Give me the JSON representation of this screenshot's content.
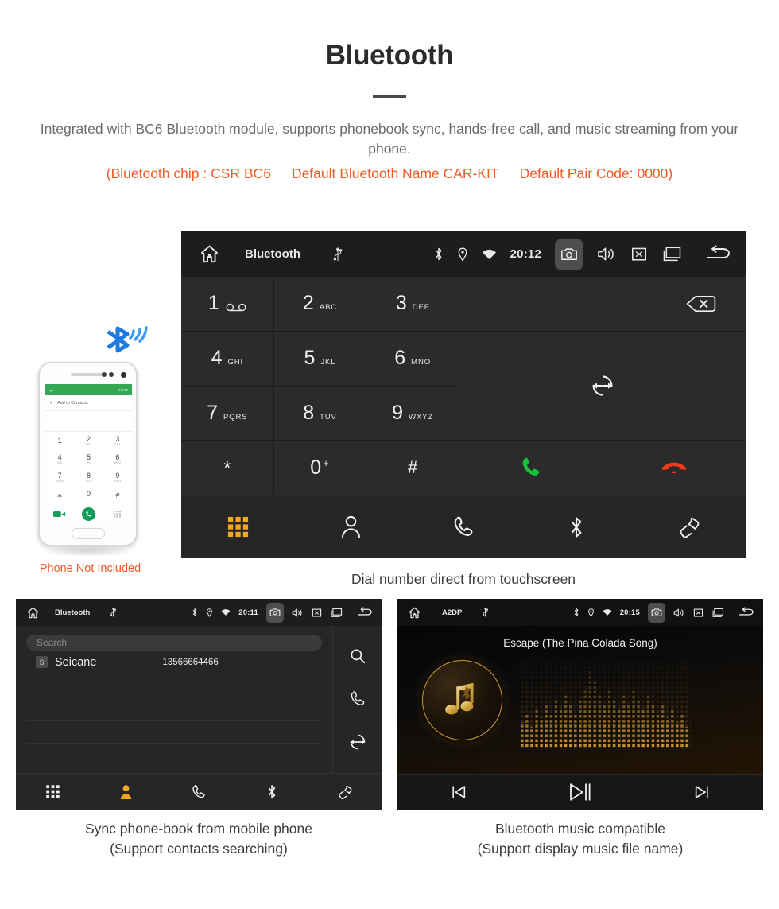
{
  "header": {
    "title": "Bluetooth",
    "subtitle": "Integrated with BC6 Bluetooth module, supports phonebook sync, hands-free call, and music streaming from your phone.",
    "spec_chip": "(Bluetooth chip : CSR BC6",
    "spec_name": "Default Bluetooth Name CAR-KIT",
    "spec_pair": "Default Pair Code: 0000)",
    "accent_color": "#f15a24",
    "body_color": "#6b6b6b"
  },
  "main_unit": {
    "statusbar": {
      "home_icon": "home-icon",
      "title": "Bluetooth",
      "usb_icon": "usb-icon",
      "bluetooth_icon": "bluetooth-icon",
      "location_icon": "location-pin-icon",
      "wifi_icon": "wifi-icon",
      "clock": "20:12",
      "camera_icon": "camera-icon",
      "volume_icon": "volume-icon",
      "mute_icon": "mute-icon",
      "recents_icon": "recents-icon",
      "back_icon": "back-icon"
    },
    "keys": [
      {
        "digit": "1",
        "sub": "",
        "sub_kind": "voicemail",
        "name": "key-1"
      },
      {
        "digit": "2",
        "sub": "ABC",
        "sub_kind": "letters",
        "name": "key-2"
      },
      {
        "digit": "3",
        "sub": "DEF",
        "sub_kind": "letters",
        "name": "key-3"
      },
      {
        "digit": "4",
        "sub": "GHI",
        "sub_kind": "letters",
        "name": "key-4"
      },
      {
        "digit": "5",
        "sub": "JKL",
        "sub_kind": "letters",
        "name": "key-5"
      },
      {
        "digit": "6",
        "sub": "MNO",
        "sub_kind": "letters",
        "name": "key-6"
      },
      {
        "digit": "7",
        "sub": "PQRS",
        "sub_kind": "letters",
        "name": "key-7"
      },
      {
        "digit": "8",
        "sub": "TUV",
        "sub_kind": "letters",
        "name": "key-8"
      },
      {
        "digit": "9",
        "sub": "WXYZ",
        "sub_kind": "letters",
        "name": "key-9"
      },
      {
        "digit": "*",
        "sub": "",
        "sub_kind": "none",
        "name": "key-star"
      },
      {
        "digit": "0",
        "sub": "+",
        "sub_kind": "plus",
        "name": "key-0"
      },
      {
        "digit": "#",
        "sub": "",
        "sub_kind": "none",
        "name": "key-hash"
      }
    ],
    "actions": {
      "backspace_icon": "backspace-icon",
      "sync_icon": "sync-icon",
      "call_icon": "call-icon",
      "hangup_icon": "hangup-icon",
      "call_color": "#14c33a",
      "hangup_color": "#ef3b1d"
    },
    "tabs": [
      {
        "name": "tab-keypad",
        "icon": "keypad-icon",
        "active": true
      },
      {
        "name": "tab-contacts",
        "icon": "contact-icon",
        "active": false
      },
      {
        "name": "tab-calllog",
        "icon": "phone-icon",
        "active": false
      },
      {
        "name": "tab-bluetooth",
        "icon": "bluetooth-icon",
        "active": false
      },
      {
        "name": "tab-link",
        "icon": "link-icon",
        "active": false
      }
    ],
    "active_tab_color": "#f5a623",
    "caption": "Dial number direct from touchscreen"
  },
  "phone_illustration": {
    "not_included_label": "Phone Not Included",
    "screen": {
      "back_icon": "back-arrow-icon",
      "more_label": "MORE",
      "add_contact_label": "Add to Contacts",
      "keys": [
        {
          "digit": "1",
          "sub": ""
        },
        {
          "digit": "2",
          "sub": "ABC"
        },
        {
          "digit": "3",
          "sub": "DEF"
        },
        {
          "digit": "4",
          "sub": "GHI"
        },
        {
          "digit": "5",
          "sub": "JKL"
        },
        {
          "digit": "6",
          "sub": "MNO"
        },
        {
          "digit": "7",
          "sub": "PQRS"
        },
        {
          "digit": "8",
          "sub": "TUV"
        },
        {
          "digit": "9",
          "sub": "WXYZ"
        },
        {
          "digit": "∗",
          "sub": ""
        },
        {
          "digit": "0",
          "sub": "+"
        },
        {
          "digit": "#",
          "sub": ""
        }
      ]
    },
    "bluetooth_wave_color": "#1f7ae0"
  },
  "phonebook_unit": {
    "statusbar": {
      "home_icon": "home-icon",
      "title": "Bluetooth",
      "usb_icon": "usb-icon",
      "clock": "20:11",
      "camera_icon": "camera-icon"
    },
    "search_placeholder": "Search",
    "contacts": [
      {
        "initial": "S",
        "name": "Seicane",
        "number": "13566664466"
      }
    ],
    "side_actions": [
      {
        "name": "search-button",
        "icon": "search-icon"
      },
      {
        "name": "call-button",
        "icon": "phone-icon"
      },
      {
        "name": "sync-button",
        "icon": "sync-icon"
      }
    ],
    "tabs": [
      {
        "name": "tab-keypad",
        "icon": "keypad-icon",
        "active": false
      },
      {
        "name": "tab-contacts",
        "icon": "contact-icon",
        "active": true
      },
      {
        "name": "tab-calllog",
        "icon": "phone-icon",
        "active": false
      },
      {
        "name": "tab-bluetooth",
        "icon": "bluetooth-icon",
        "active": false
      },
      {
        "name": "tab-link",
        "icon": "link-icon",
        "active": false
      }
    ],
    "caption_line1": "Sync phone-book from mobile phone",
    "caption_line2": "(Support contacts searching)"
  },
  "music_unit": {
    "statusbar": {
      "home_icon": "home-icon",
      "title": "A2DP",
      "usb_icon": "usb-icon",
      "clock": "20:15",
      "camera_icon": "camera-icon"
    },
    "track_title": "Escape (The Pina Colada Song)",
    "album_art_icon": "music-note-bluetooth-icon",
    "controls": [
      {
        "name": "previous-button",
        "icon": "previous-track-icon"
      },
      {
        "name": "play-pause-button",
        "icon": "play-pause-icon"
      },
      {
        "name": "next-button",
        "icon": "next-track-icon"
      }
    ],
    "accent_color": "#c9962f",
    "caption_line1": "Bluetooth music compatible",
    "caption_line2": "(Support display music file name)"
  }
}
